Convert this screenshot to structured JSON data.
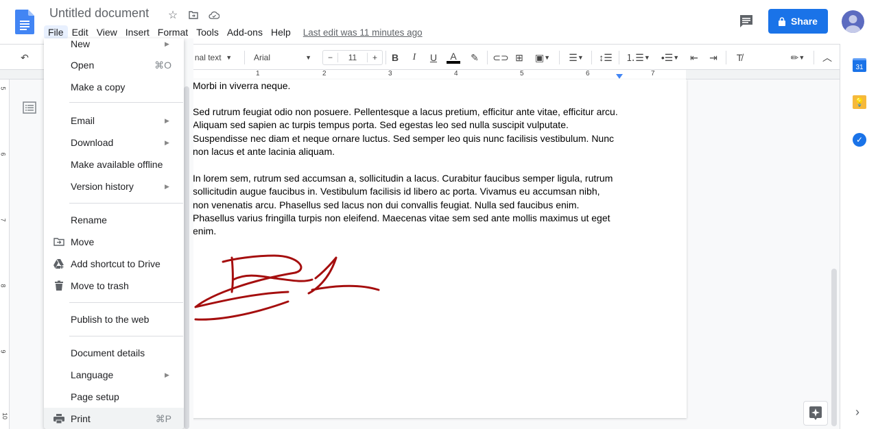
{
  "header": {
    "title": "Untitled document",
    "menus": [
      "File",
      "Edit",
      "View",
      "Insert",
      "Format",
      "Tools",
      "Add-ons",
      "Help"
    ],
    "active_menu": "File",
    "last_edit": "Last edit was 11 minutes ago",
    "share_label": "Share",
    "colors": {
      "share": "#1a73e8",
      "avatar": "#5c6bc0"
    }
  },
  "toolbar": {
    "style": "Normal text",
    "style_visible": "nal text",
    "font": "Arial",
    "font_size": "11",
    "minus": "−",
    "plus": "+"
  },
  "ruler": {
    "numbers": [
      "1",
      "2",
      "3",
      "4",
      "5",
      "6",
      "7"
    ]
  },
  "vruler": {
    "numbers": [
      "5",
      "6",
      "7",
      "8",
      "9",
      "10"
    ]
  },
  "document": {
    "paragraphs": [
      "Morbi in viverra neque.",
      "Sed rutrum feugiat odio non posuere. Pellentesque a lacus pretium, efficitur ante vitae, efficitur arcu. Aliquam sed sapien ac turpis tempus porta. Sed egestas leo sed nulla suscipit vulputate. Suspendisse nec diam et neque ornare luctus. Sed semper leo quis nunc facilisis vestibulum. Nunc non lacus et ante lacinia aliquam.",
      "In lorem sem, rutrum sed accumsan a, sollicitudin a lacus. Curabitur faucibus semper ligula, rutrum sollicitudin augue faucibus in. Vestibulum facilisis id libero ac porta. Vivamus eu accumsan nibh, non venenatis arcu. Phasellus sed lacus non dui convallis feugiat. Nulla sed faucibus enim. Phasellus varius fringilla turpis non eleifend. Maecenas vitae sem sed ante mollis maximus ut eget enim."
    ],
    "signature_color": "#a50e0e"
  },
  "file_menu": {
    "items": [
      {
        "label": "New",
        "arrow": "▶"
      },
      {
        "label": "Open",
        "shortcut": "⌘O"
      },
      {
        "label": "Make a copy"
      },
      {
        "label": "Email",
        "arrow": "▶"
      },
      {
        "label": "Download",
        "arrow": "▶"
      },
      {
        "label": "Make available offline"
      },
      {
        "label": "Version history",
        "arrow": "▶"
      },
      {
        "label": "Rename"
      },
      {
        "label": "Move",
        "icon": "move-folder-icon"
      },
      {
        "label": "Add shortcut to Drive",
        "icon": "drive-shortcut-icon"
      },
      {
        "label": "Move to trash",
        "icon": "trash-icon"
      },
      {
        "label": "Publish to the web"
      },
      {
        "label": "Document details"
      },
      {
        "label": "Language",
        "arrow": "▶"
      },
      {
        "label": "Page setup"
      },
      {
        "label": "Print",
        "shortcut": "⌘P",
        "icon": "print-icon",
        "highlighted": true
      }
    ]
  },
  "sidepanel": {
    "calendar_day": "31",
    "expand": "›"
  }
}
